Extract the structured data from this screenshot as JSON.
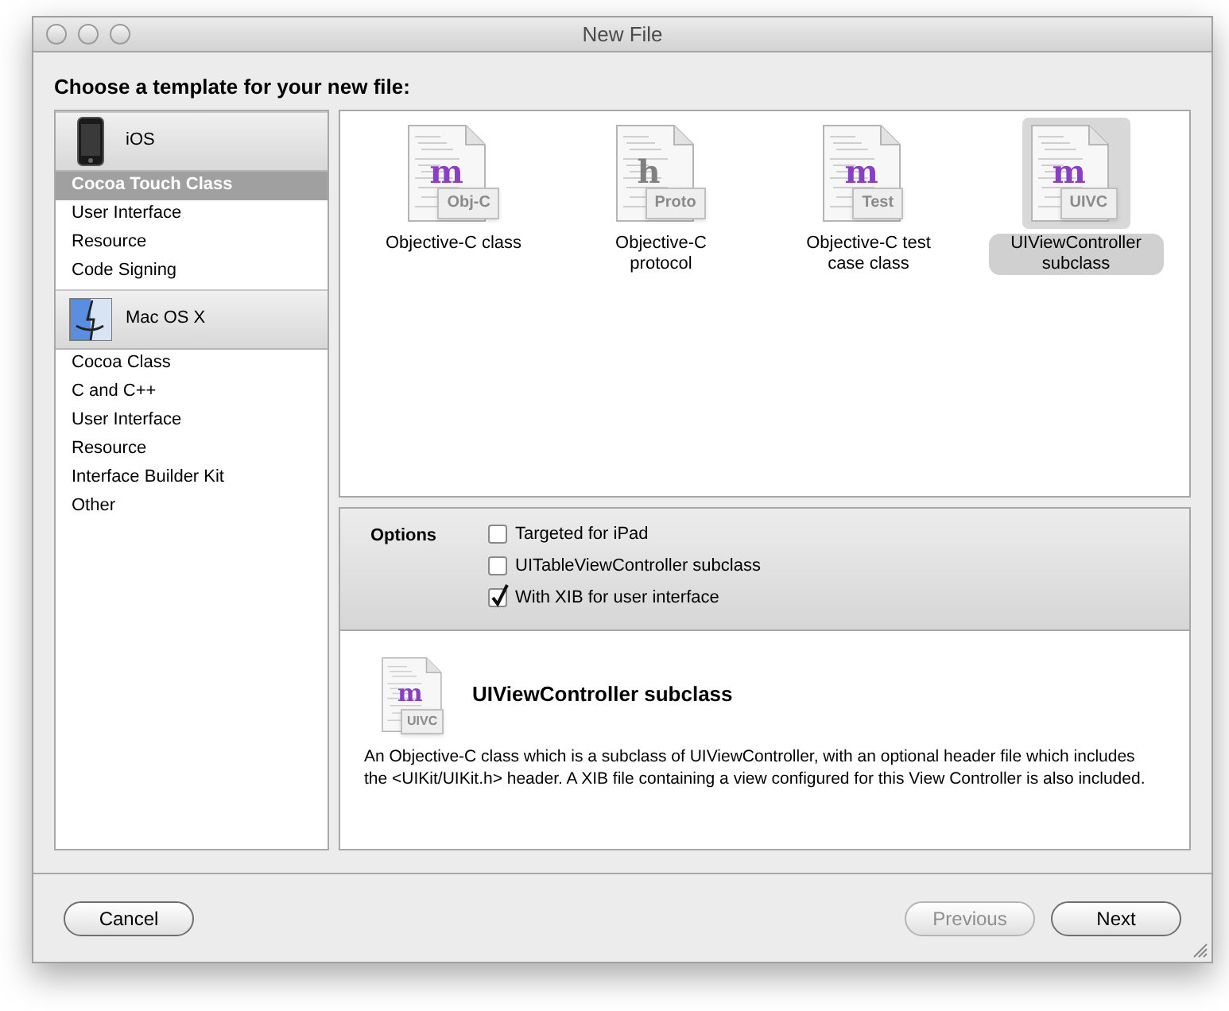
{
  "window": {
    "title": "New File"
  },
  "heading": "Choose a template for your new file:",
  "sidebar": [
    {
      "title": "iOS",
      "kind": "phone",
      "items": [
        {
          "label": "Cocoa Touch Class",
          "selected": true
        },
        {
          "label": "User Interface",
          "selected": false
        },
        {
          "label": "Resource",
          "selected": false
        },
        {
          "label": "Code Signing",
          "selected": false
        }
      ]
    },
    {
      "title": "Mac OS X",
      "kind": "finder",
      "items": [
        {
          "label": "Cocoa Class",
          "selected": false
        },
        {
          "label": "C and C++",
          "selected": false
        },
        {
          "label": "User Interface",
          "selected": false
        },
        {
          "label": "Resource",
          "selected": false
        },
        {
          "label": "Interface Builder Kit",
          "selected": false
        },
        {
          "label": "Other",
          "selected": false
        }
      ]
    }
  ],
  "templates": [
    {
      "label": "Objective-C class",
      "glyph": "m",
      "tag": "Obj-C",
      "selected": false
    },
    {
      "label": "Objective-C protocol",
      "glyph": "h",
      "tag": "Proto",
      "selected": false
    },
    {
      "label": "Objective-C test case class",
      "glyph": "m",
      "tag": "Test",
      "selected": false
    },
    {
      "label": "UIViewController subclass",
      "glyph": "m",
      "tag": "UIVC",
      "selected": true
    }
  ],
  "options": {
    "label": "Options",
    "items": [
      {
        "label": "Targeted for iPad",
        "checked": false
      },
      {
        "label": "UITableViewController subclass",
        "checked": false
      },
      {
        "label": "With XIB for user interface",
        "checked": true
      }
    ]
  },
  "description": {
    "glyph": "m",
    "tag": "UIVC",
    "title": "UIViewController subclass",
    "text": "An Objective-C class which is a subclass of UIViewController, with an optional header file which includes the <UIKit/UIKit.h> header. A XIB file containing a view configured for this View Controller is also included."
  },
  "buttons": [
    {
      "label": "Cancel",
      "disabled": false
    },
    {
      "label": "Previous",
      "disabled": true
    },
    {
      "label": "Next",
      "disabled": false
    }
  ]
}
